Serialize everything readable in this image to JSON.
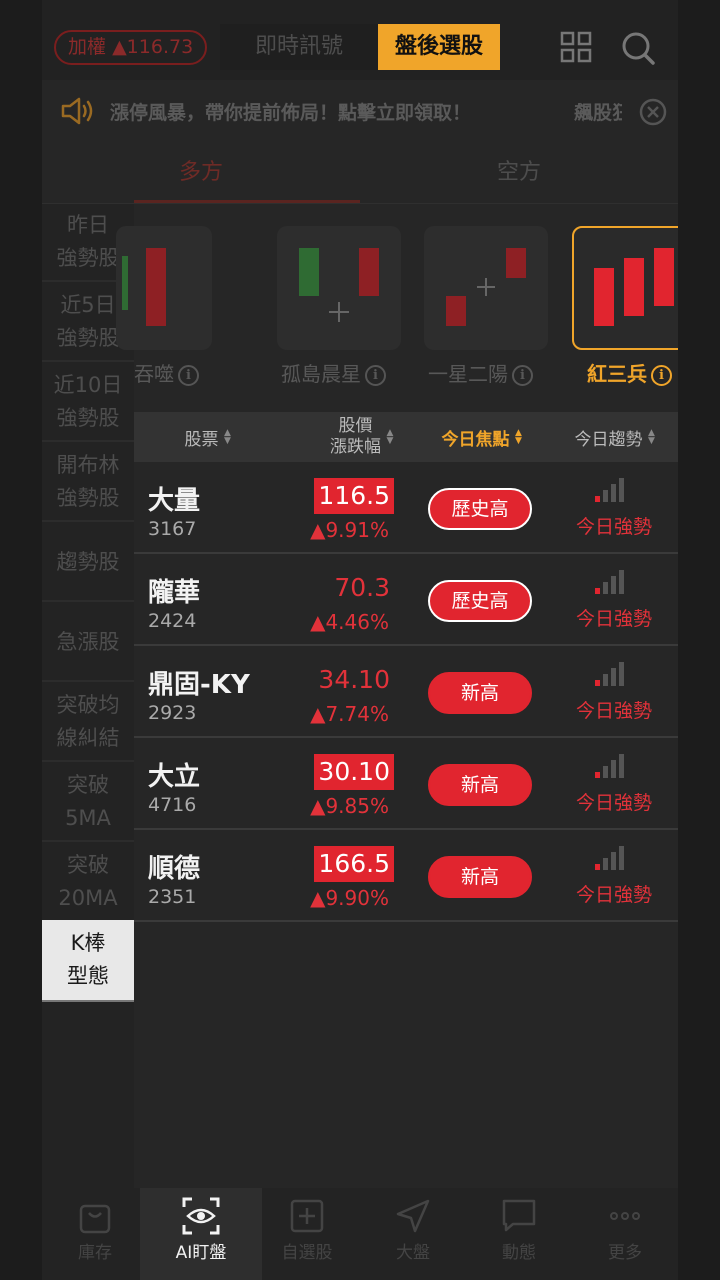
{
  "header": {
    "index_name": "加權",
    "index_change": "▲116.73",
    "tab_live": "即時訊號",
    "tab_after": "盤後選股"
  },
  "marquee": {
    "text": "漲停風暴，帶你提前佈局！點擊立即領取！",
    "text2": "飆股狂"
  },
  "direction_tabs": {
    "long": "多方",
    "short": "空方"
  },
  "categories": [
    {
      "label": "昨日\n強勢股"
    },
    {
      "label": "近5日\n強勢股"
    },
    {
      "label": "近10日\n強勢股"
    },
    {
      "label": "開布林\n強勢股"
    },
    {
      "label": "趨勢股"
    },
    {
      "label": "急漲股"
    },
    {
      "label": "突破均\n線糾結"
    },
    {
      "label": "突破\n5MA"
    },
    {
      "label": "突破\n20MA"
    },
    {
      "label": "K棒\n型態"
    }
  ],
  "patterns": [
    {
      "label": "吞噬"
    },
    {
      "label": "孤島晨星"
    },
    {
      "label": "一星二陽"
    },
    {
      "label": "紅三兵"
    }
  ],
  "table": {
    "headers": {
      "stock": "股票",
      "price_line1": "股價",
      "price_line2": "漲跌幅",
      "focus": "今日焦點",
      "trend": "今日趨勢"
    },
    "rows": [
      {
        "name": "大量",
        "code": "3167",
        "price": "116.5",
        "change": "▲9.91%",
        "focus": "歷史高",
        "trend": "今日強勢"
      },
      {
        "name": "隴華",
        "code": "2424",
        "price": "70.3",
        "change": "▲4.46%",
        "focus": "歷史高",
        "trend": "今日強勢"
      },
      {
        "name": "鼎固-KY",
        "code": "2923",
        "price": "34.10",
        "change": "▲7.74%",
        "focus": "新高",
        "trend": "今日強勢"
      },
      {
        "name": "大立",
        "code": "4716",
        "price": "30.10",
        "change": "▲9.85%",
        "focus": "新高",
        "trend": "今日強勢"
      },
      {
        "name": "順德",
        "code": "2351",
        "price": "166.5",
        "change": "▲9.90%",
        "focus": "新高",
        "trend": "今日強勢"
      }
    ]
  },
  "bottom_nav": [
    {
      "label": "庫存",
      "icon": "bag-icon"
    },
    {
      "label": "AI盯盤",
      "icon": "eye-scan-icon"
    },
    {
      "label": "自選股",
      "icon": "plus-square-icon"
    },
    {
      "label": "大盤",
      "icon": "navigation-arrow-icon"
    },
    {
      "label": "動態",
      "icon": "chat-bubble-icon"
    },
    {
      "label": "更多",
      "icon": "more-dots-icon"
    }
  ],
  "colors": {
    "accent": "#f0a52a",
    "up_red": "#e1252f",
    "background": "#262626"
  }
}
